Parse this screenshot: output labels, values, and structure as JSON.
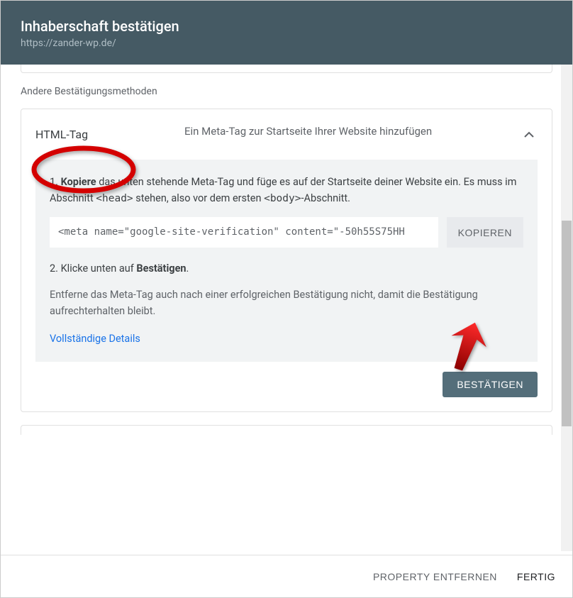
{
  "header": {
    "title": "Inhaberschaft bestätigen",
    "subtitle": "https://zander-wp.de/"
  },
  "section_label": "Andere Bestätigungsmethoden",
  "card": {
    "title": "HTML-Tag",
    "description": "Ein Meta-Tag zur Startseite Ihrer Website hinzufügen"
  },
  "step1": {
    "prefix": "1. ",
    "bold": "Kopiere",
    "text_a": " das unten stehende Meta-Tag und füge es auf der Startseite deiner Website ein. Es muss im Abschnitt ",
    "code1": "<head>",
    "text_b": " stehen, also vor dem ersten ",
    "code2": "<body>",
    "text_c": "-Abschnitt."
  },
  "meta_code": "<meta name=\"google-site-verification\" content=\"-50h55S75HH",
  "copy_label": "KOPIEREN",
  "step2": {
    "prefix": "2. Klicke unten auf ",
    "bold": "Bestätigen",
    "suffix": "."
  },
  "note": "Entferne das Meta-Tag auch nach einer erfolgreichen Bestätigung nicht, damit die Bestätigung aufrechterhalten bleibt.",
  "details_link": "Vollständige Details",
  "confirm_label": "BESTÄTIGEN",
  "footer": {
    "remove": "PROPERTY ENTFERNEN",
    "done": "FERTIG"
  }
}
